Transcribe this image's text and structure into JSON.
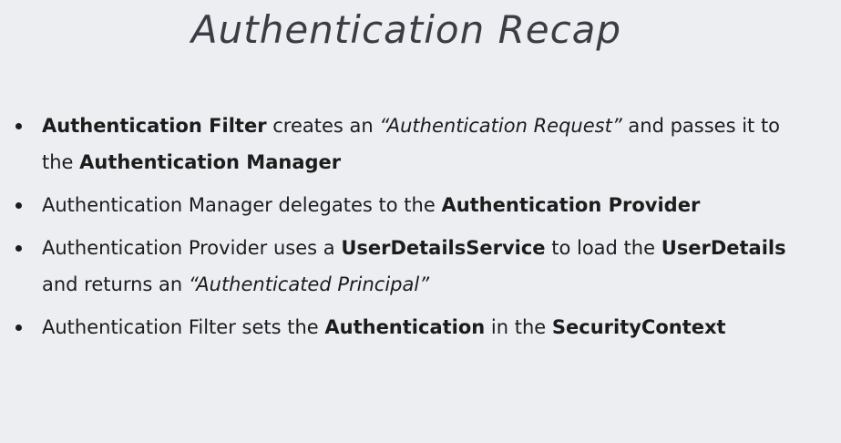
{
  "slide": {
    "title": "Authentication Recap",
    "bullets": [
      {
        "segments": [
          {
            "text": "Authentication Filter",
            "style": "bold"
          },
          {
            "text": " creates an ",
            "style": "normal"
          },
          {
            "text": "“Authentication Request”",
            "style": "italic"
          },
          {
            "text": " and passes it to the ",
            "style": "normal"
          },
          {
            "text": "Authentication Manager",
            "style": "bold"
          }
        ]
      },
      {
        "segments": [
          {
            "text": "Authentication Manager delegates to the ",
            "style": "normal"
          },
          {
            "text": "Authentication Provider",
            "style": "bold"
          }
        ]
      },
      {
        "segments": [
          {
            "text": "Authentication Provider uses a ",
            "style": "normal"
          },
          {
            "text": "UserDetailsService",
            "style": "bold"
          },
          {
            "text": " to load the ",
            "style": "normal"
          },
          {
            "text": "UserDetails",
            "style": "bold"
          },
          {
            "text": " and returns an ",
            "style": "normal"
          },
          {
            "text": "“Authenticated Principal”",
            "style": "italic"
          }
        ]
      },
      {
        "segments": [
          {
            "text": "Authentication Filter sets the ",
            "style": "normal"
          },
          {
            "text": "Authentication",
            "style": "bold"
          },
          {
            "text": " in the ",
            "style": "normal"
          },
          {
            "text": "SecurityContext",
            "style": "bold"
          }
        ]
      }
    ]
  }
}
